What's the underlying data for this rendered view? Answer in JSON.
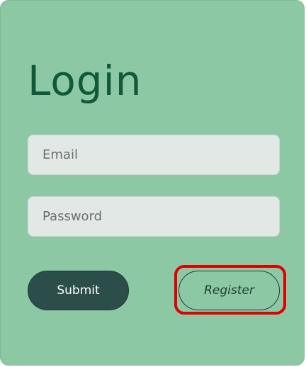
{
  "login": {
    "title": "Login",
    "email_placeholder": "Email",
    "password_placeholder": "Password",
    "submit_label": "Submit",
    "register_label": "Register"
  },
  "colors": {
    "card_background": "#8dc8a4",
    "title": "#0f5a3a",
    "submit_background": "#2c4e4b",
    "highlight": "#e00000"
  }
}
